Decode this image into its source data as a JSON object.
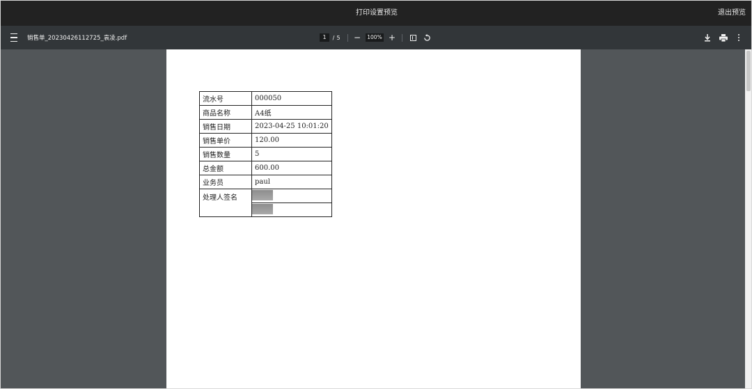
{
  "window": {
    "title": "打印设置预览",
    "exit_label": "退出预览"
  },
  "toolbar": {
    "file_name": "销售单_20230426112725_袁凌.pdf",
    "current_page": "1",
    "page_separator": "/",
    "total_pages": "5",
    "zoom_level": "100%",
    "icons": [
      "menu-icon",
      "zoom-out-icon",
      "zoom-in-icon",
      "fit-page-icon",
      "rotate-icon",
      "download-icon",
      "print-icon",
      "more-options-icon"
    ]
  },
  "record": {
    "rows": [
      {
        "label": "流水号",
        "value": "000050"
      },
      {
        "label": "商品名称",
        "value": "A4纸"
      },
      {
        "label": "销售日期",
        "value": "2023-04-25 10:01:20"
      },
      {
        "label": "销售单价",
        "value": "120.00"
      },
      {
        "label": "销售数量",
        "value": "5"
      },
      {
        "label": "总金额",
        "value": "600.00"
      },
      {
        "label": "业务员",
        "value": "paul"
      }
    ],
    "signature_label": "处理人签名"
  },
  "colors": {
    "title_bar": "#222222",
    "toolbar": "#323639",
    "viewer_bg": "#525659",
    "page": "#ffffff"
  }
}
